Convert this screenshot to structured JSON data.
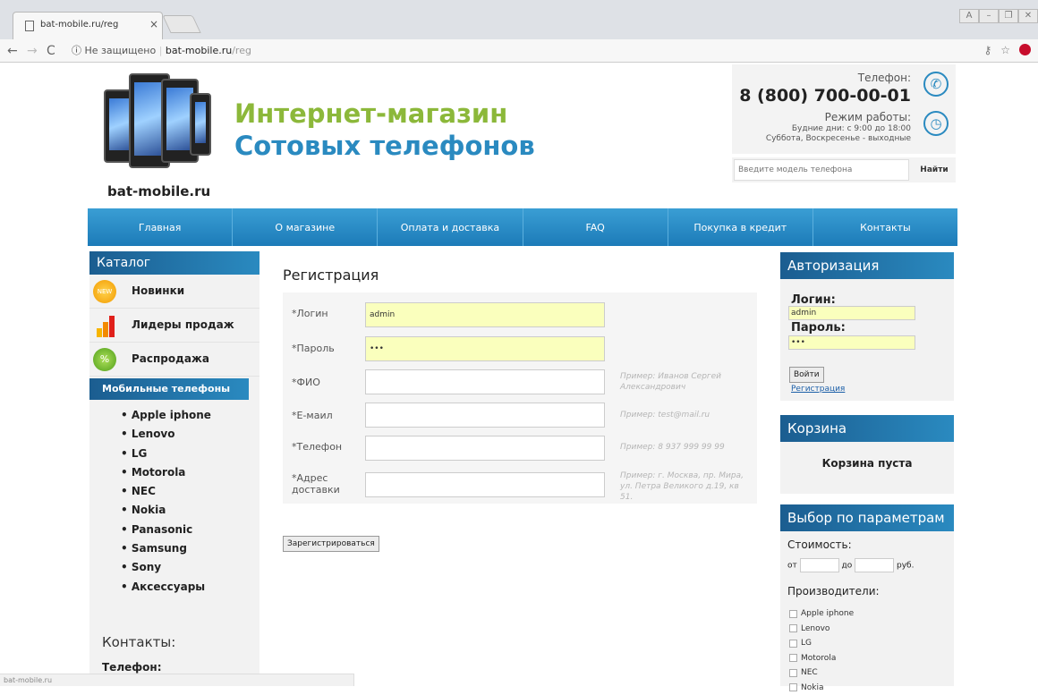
{
  "browser": {
    "tab_title": "bat-mobile.ru/reg",
    "tab_close": "×",
    "security": "Не защищено",
    "url_host": "bat-mobile.ru",
    "url_path": "/reg",
    "status_url": "bat-mobile.ru"
  },
  "header": {
    "site_name": "bat-mobile.ru",
    "title_line1": "Интернет-магазин",
    "title_line2": "Сотовых телефонов",
    "phone_label": "Телефон:",
    "phone_number": "8 (800) 700-00-01",
    "hours_label": "Режим работы:",
    "hours_weekdays": "Будние дни: с 9:00 до 18:00",
    "hours_weekend": "Суббота, Воскресенье - выходные",
    "search_placeholder": "Введите модель телефона",
    "search_button": "Найти"
  },
  "nav": [
    "Главная",
    "О магазине",
    "Оплата и доставка",
    "FAQ",
    "Покупка в кредит",
    "Контакты"
  ],
  "catalog": {
    "heading": "Каталог",
    "items": [
      "Новинки",
      "Лидеры продаж",
      "Распродажа"
    ],
    "new_badge": "NEW",
    "sale_badge": "%",
    "active_item": "Мобильные телефоны",
    "brands": [
      "Apple iphone",
      "Lenovo",
      "LG",
      "Motorola",
      "NEC",
      "Nokia",
      "Panasonic",
      "Samsung",
      "Sony",
      "Аксессуары"
    ],
    "contacts_heading": "Контакты:",
    "contacts_phone": "Телефон:"
  },
  "registration": {
    "title": "Регистрация",
    "fields": [
      {
        "label": "*Логин",
        "value": "admin",
        "hint": ""
      },
      {
        "label": "*Пароль",
        "value": "•••",
        "hint": ""
      },
      {
        "label": "*ФИО",
        "value": "",
        "hint": "Пример: Иванов Сергей Александрович"
      },
      {
        "label": "*E-маил",
        "value": "",
        "hint": "Пример: test@mail.ru"
      },
      {
        "label": "*Телефон",
        "value": "",
        "hint": "Пример: 8 937 999 99 99"
      },
      {
        "label": "*Адрес доставки",
        "value": "",
        "hint": "Пример: г. Москва, пр. Мира, ул. Петра Великого д.19, кв 51."
      }
    ],
    "submit": "Зарегистрироваться"
  },
  "auth": {
    "heading": "Авторизация",
    "login_label": "Логин:",
    "login_value": "admin",
    "password_label": "Пароль:",
    "password_value": "•••",
    "login_button": "Войти",
    "register_link": "Регистрация"
  },
  "cart": {
    "heading": "Корзина",
    "empty_text": "Корзина пуста"
  },
  "filter": {
    "heading": "Выбор по параметрам",
    "cost_label": "Стоимость:",
    "from": "от",
    "to": "до",
    "currency": "руб.",
    "manufacturers_label": "Производители:",
    "manufacturers": [
      "Apple iphone",
      "Lenovo",
      "LG",
      "Motorola",
      "NEC",
      "Nokia"
    ]
  },
  "colors": {
    "accent_blue": "#2a8ac0",
    "title_green": "#8cb83a",
    "autofill_yellow": "#faffbd"
  }
}
